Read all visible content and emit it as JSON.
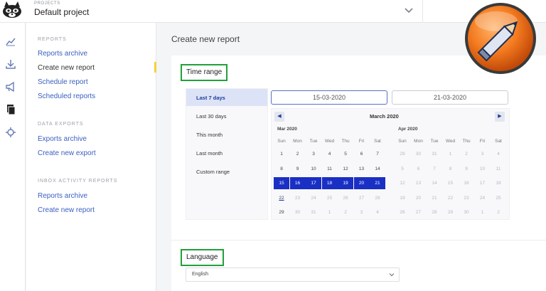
{
  "header": {
    "projects_label": "PROJECTS",
    "project_name": "Default project"
  },
  "nav": {
    "sections": [
      {
        "title": "REPORTS",
        "items": [
          {
            "label": "Reports archive"
          },
          {
            "label": "Create new report",
            "active": true
          },
          {
            "label": "Schedule report"
          },
          {
            "label": "Scheduled reports"
          }
        ]
      },
      {
        "title": "DATA EXPORTS",
        "items": [
          {
            "label": "Exports archive"
          },
          {
            "label": "Create new export"
          }
        ]
      },
      {
        "title": "INBOX ACTIVITY REPORTS",
        "items": [
          {
            "label": "Reports archive"
          },
          {
            "label": "Create new report"
          }
        ]
      }
    ]
  },
  "main": {
    "title": "Create new report",
    "time_range_label": "Time range",
    "language_label": "Language",
    "language_value": "English"
  },
  "ranges": [
    "Last 7 days",
    "Last 30 days",
    "This month",
    "Last month",
    "Custom range"
  ],
  "active_range": 0,
  "calendar": {
    "start_date": "15-03-2020",
    "end_date": "21-03-2020",
    "header": "March 2020",
    "prev": "◀",
    "next": "▶",
    "weekdays": [
      "Sun",
      "Mon",
      "Tue",
      "Wed",
      "Thu",
      "Fri",
      "Sat"
    ],
    "months": [
      {
        "label": "Mar 2020",
        "weeks": [
          [
            1,
            2,
            3,
            4,
            5,
            6,
            7
          ],
          [
            8,
            9,
            10,
            11,
            12,
            13,
            14
          ],
          [
            15,
            16,
            17,
            18,
            19,
            20,
            21
          ],
          [
            22,
            23,
            24,
            25,
            26,
            27,
            28
          ],
          [
            29,
            30,
            31,
            1,
            2,
            3,
            4
          ]
        ],
        "muted": [
          [
            3,
            1
          ],
          [
            3,
            2
          ],
          [
            3,
            3
          ],
          [
            3,
            4
          ],
          [
            3,
            5
          ],
          [
            3,
            6
          ],
          [
            4,
            1
          ],
          [
            4,
            2
          ],
          [
            4,
            3
          ],
          [
            4,
            4
          ],
          [
            4,
            5
          ],
          [
            4,
            6
          ]
        ],
        "selected_week": 2,
        "today": [
          3,
          0
        ]
      },
      {
        "label": "Apr 2020",
        "weeks": [
          [
            29,
            30,
            31,
            1,
            2,
            3,
            4
          ],
          [
            5,
            6,
            7,
            8,
            9,
            10,
            11
          ],
          [
            12,
            13,
            14,
            15,
            16,
            17,
            18
          ],
          [
            19,
            20,
            21,
            22,
            23,
            24,
            25
          ],
          [
            26,
            27,
            28,
            29,
            30,
            1,
            2
          ]
        ],
        "all_muted": true
      }
    ]
  },
  "colors": {
    "accent": "#1a2fc4",
    "highlight_box": "#22a03a",
    "nav_indicator": "#f3d13f",
    "badge": "#f47b20"
  }
}
